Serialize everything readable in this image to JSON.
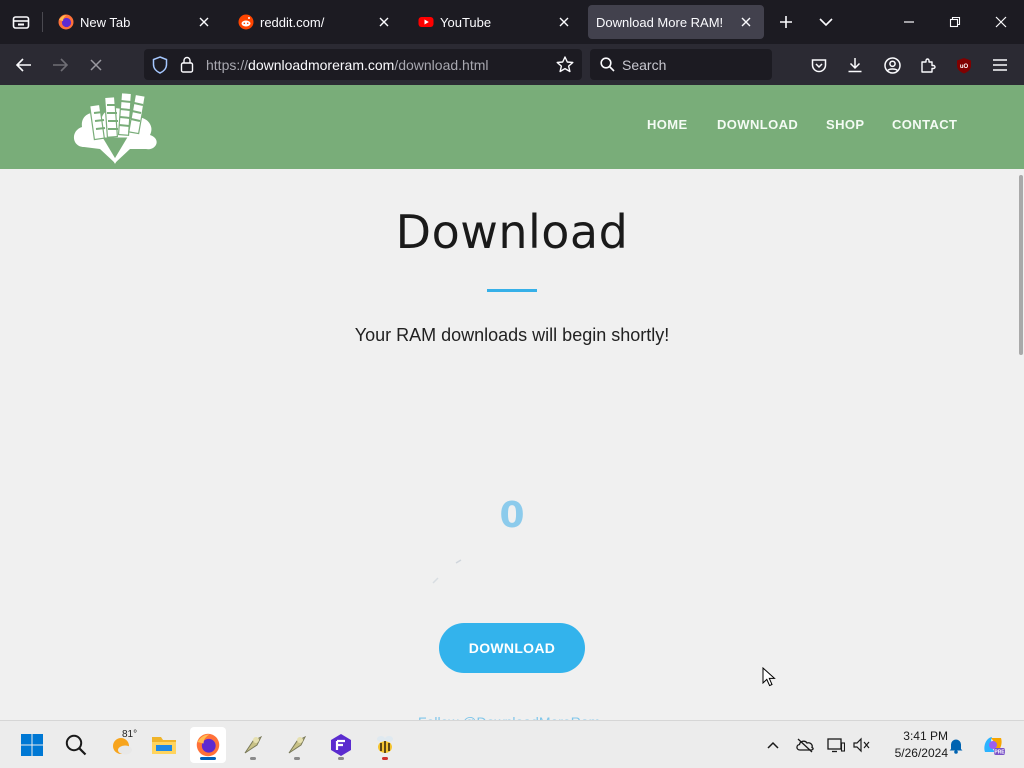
{
  "browser": {
    "tabs": [
      {
        "title": "New Tab",
        "icon": "firefox-icon"
      },
      {
        "title": "reddit.com/",
        "icon": "reddit-icon"
      },
      {
        "title": "YouTube",
        "icon": "youtube-icon"
      },
      {
        "title": "Download More RAM!",
        "icon": "none",
        "active": true
      }
    ],
    "url": {
      "scheme": "https://",
      "host": "downloadmoreram.com",
      "path": "/download.html"
    },
    "search_placeholder": "Search"
  },
  "site": {
    "nav": [
      "HOME",
      "DOWNLOAD",
      "SHOP",
      "CONTACT"
    ],
    "header_color": "#79ad79"
  },
  "page": {
    "title": "Download",
    "subtitle": "Your RAM downloads will begin shortly!",
    "counter": "0",
    "download_button": "DOWNLOAD",
    "accent_color": "#33b3ec"
  },
  "taskbar": {
    "weather_temp": "81°",
    "time": "3:41 PM",
    "date": "5/26/2024"
  }
}
